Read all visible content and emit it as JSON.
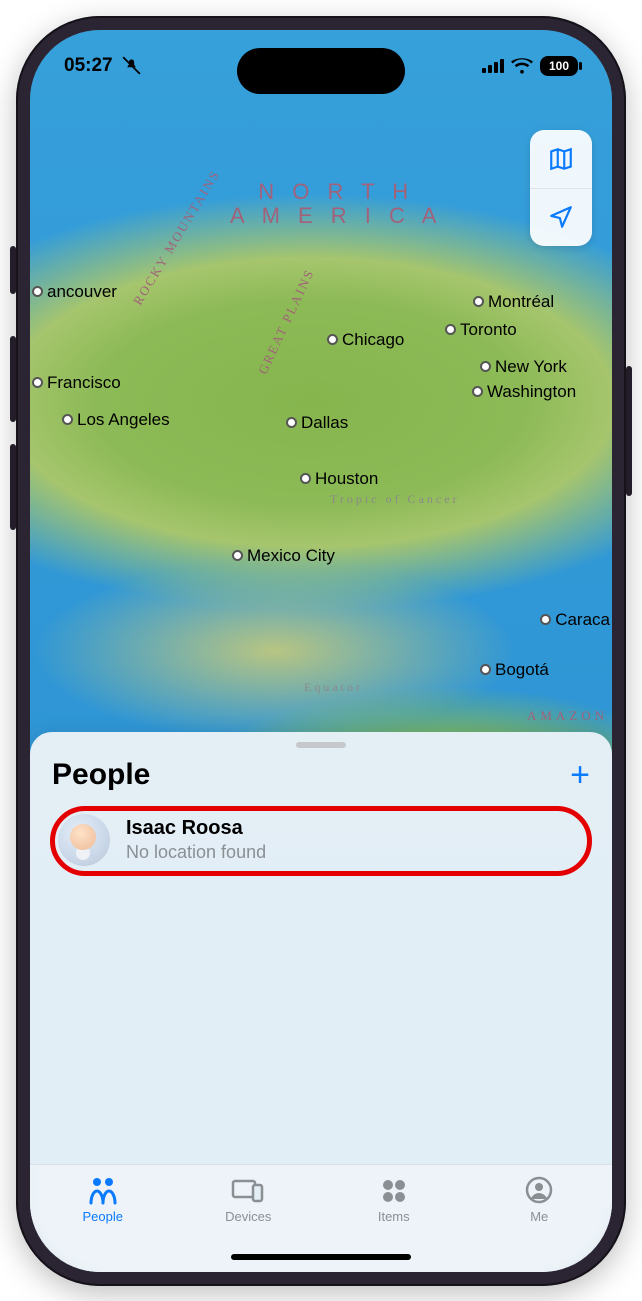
{
  "status": {
    "time": "05:27",
    "battery": "100"
  },
  "map": {
    "continent_line1": "N O R T H",
    "continent_line2": "A M E R I C A",
    "terrain_rocky": "ROCKY MOUNTAINS",
    "terrain_plains": "GREAT PLAINS",
    "terrain_amazon": "AMAZON",
    "line_tropic": "Tropic of Cancer",
    "line_equator": "Equator",
    "cities": {
      "vancouver": "ancouver",
      "francisco": "Francisco",
      "los_angeles": "Los Angeles",
      "chicago": "Chicago",
      "dallas": "Dallas",
      "houston": "Houston",
      "mexico_city": "Mexico City",
      "montreal": "Montréal",
      "toronto": "Toronto",
      "new_york": "New York",
      "washington": "Washington",
      "caracas": "Caraca",
      "bogota": "Bogotá"
    }
  },
  "sheet": {
    "title": "People",
    "person": {
      "name": "Isaac Roosa",
      "subtitle": "No location found"
    }
  },
  "tabs": {
    "people": "People",
    "devices": "Devices",
    "items": "Items",
    "me": "Me"
  }
}
